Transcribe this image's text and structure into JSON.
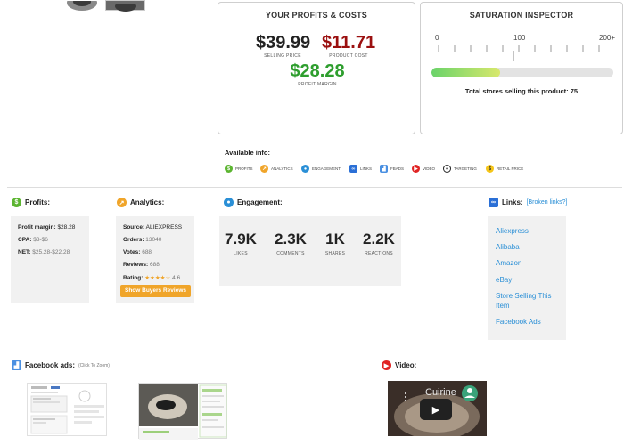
{
  "profits_costs": {
    "title": "YOUR PROFITS & COSTS",
    "selling_price": "$39.99",
    "selling_price_label": "SELLING PRICE",
    "product_cost": "$11.71",
    "product_cost_label": "PRODUCT COST",
    "profit_margin": "$28.28",
    "profit_margin_label": "PROFIT MARGIN"
  },
  "saturation": {
    "title": "SATURATION INSPECTOR",
    "scale_labels": [
      "0",
      "100",
      "200+"
    ],
    "level_fraction": 0.375,
    "total_label": "Total stores selling this product:",
    "total_value": "75"
  },
  "available_info": {
    "heading": "Available info:",
    "items": [
      {
        "label": "PROFITS",
        "icon": "dollar-icon",
        "color": "#5cb531"
      },
      {
        "label": "ANALYTICS",
        "icon": "analytics-icon",
        "color": "#f0a52a"
      },
      {
        "label": "ENGAGEMENT",
        "icon": "drop-icon",
        "color": "#2a8fd6"
      },
      {
        "label": "LINKS",
        "icon": "link-icon",
        "color": "#2a6fd6"
      },
      {
        "label": "FBADS",
        "icon": "fbads-icon",
        "color": "#4a90e2"
      },
      {
        "label": "VIDEO",
        "icon": "play-icon",
        "color": "#e02424"
      },
      {
        "label": "TARGETING",
        "icon": "target-icon",
        "color": "#222222"
      },
      {
        "label": "RETAIL PRICE",
        "icon": "price-tag-icon",
        "color": "#f5c518"
      }
    ]
  },
  "profits": {
    "heading": "Profits:",
    "margin_label": "Profit margin:",
    "margin_value": "$28.28",
    "cpa_label": "CPA:",
    "cpa_value": "$3-$6",
    "net_label": "NET:",
    "net_value": "$25.28-$22.28"
  },
  "analytics": {
    "heading": "Analytics:",
    "source_label": "Source:",
    "source_value": "ALIEXPRESS",
    "orders_label": "Orders:",
    "orders_value": "13040",
    "votes_label": "Votes:",
    "votes_value": "688",
    "reviews_label": "Reviews:",
    "reviews_value": "688",
    "rating_label": "Rating:",
    "rating_value": "4.6",
    "stars": "★★★★☆",
    "button": "Show Buyers Reviews"
  },
  "engagement": {
    "heading": "Engagement:",
    "stats": [
      {
        "value": "7.9K",
        "label": "LIKES"
      },
      {
        "value": "2.3K",
        "label": "COMMENTS"
      },
      {
        "value": "1K",
        "label": "SHARES"
      },
      {
        "value": "2.2K",
        "label": "REACTIONS"
      }
    ]
  },
  "links": {
    "heading": "Links:",
    "broken": "[Broken links?]",
    "items": [
      "Aliexpress",
      "Alibaba",
      "Amazon",
      "eBay",
      "Store Selling This Item",
      "Facebook Ads"
    ]
  },
  "facebook_ads": {
    "heading": "Facebook ads:",
    "note": "(Click To Zoom)"
  },
  "video": {
    "heading": "Video:",
    "title_text": "Cuirine"
  }
}
